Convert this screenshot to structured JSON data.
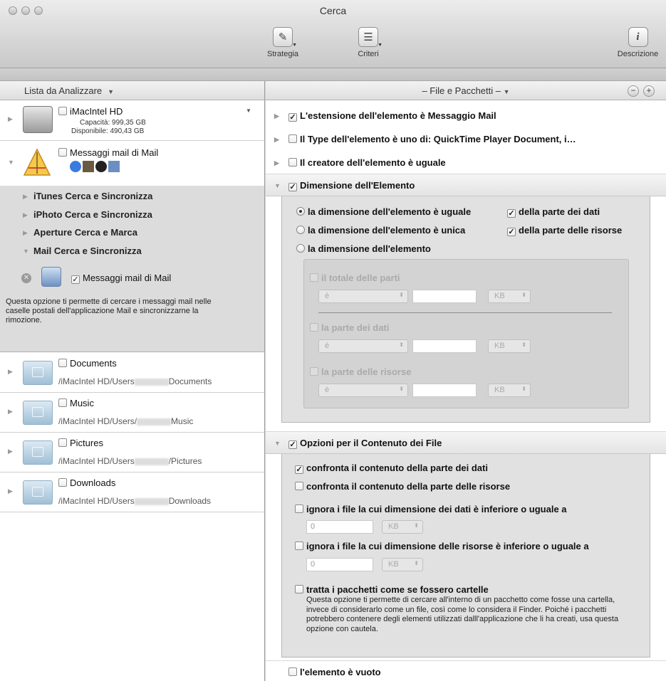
{
  "window": {
    "title": "Cerca"
  },
  "toolbar": {
    "strategy": "Strategia",
    "criteria": "Criteri",
    "description": "Descrizione"
  },
  "left": {
    "header": "Lista da Analizzare",
    "disk": {
      "name": "iMacIntel HD",
      "capacity": "Capacità: 999,35 GB",
      "available": "Disponibile: 490,43 GB"
    },
    "mail": {
      "name": "Messaggi mail di Mail",
      "sections": [
        "iTunes Cerca e Sincronizza",
        "iPhoto Cerca e Sincronizza",
        "Aperture Cerca e Marca",
        "Mail Cerca e Sincronizza"
      ],
      "option": "Messaggi mail di Mail",
      "description": "Questa opzione ti permette di cercare i messaggi mail nelle caselle postali dell'applicazione Mail e sincronizzarne la rimozione."
    },
    "folders": [
      {
        "name": "Documents",
        "path_a": "/iMacIntel HD/Users",
        "path_b": "Documents"
      },
      {
        "name": "Music",
        "path_a": "/iMacIntel HD/Users/",
        "path_b": "Music"
      },
      {
        "name": "Pictures",
        "path_a": "/iMacIntel HD/Users",
        "path_b": "/Pictures"
      },
      {
        "name": "Downloads",
        "path_a": "/iMacIntel HD/Users",
        "path_b": "Downloads"
      }
    ]
  },
  "right": {
    "header": "– File e Pacchetti –",
    "criteria": [
      "L'estensione dell'elemento è Messaggio Mail",
      "Il Type dell'elemento è uno di: QuickTime Player Document, i…",
      "Il creatore dell'elemento è uguale",
      "Dimensione dell'Elemento"
    ],
    "size": {
      "radio1": "la dimensione dell'elemento è uguale",
      "radio2": "la dimensione dell'elemento è unica",
      "radio3": "la dimensione dell'elemento",
      "check_data": "della parte dei dati",
      "check_res": "della parte delle risorse",
      "total": "il totale delle parti",
      "data_part": "la parte dei dati",
      "res_part": "la parte delle risorse",
      "op": "è",
      "unit": "KB"
    },
    "content": {
      "title": "Opzioni per il Contenuto dei File",
      "cmp_data": "confronta il contenuto della parte dei dati",
      "cmp_res": "confronta il contenuto della parte delle risorse",
      "ign_data": "ignora i file la cui dimensione dei dati è inferiore o uguale a",
      "ign_res": "ignora i file la cui dimensione delle risorse è inferiore o uguale a",
      "zero": "0",
      "unit": "KB",
      "packages": "tratta i pacchetti come se fossero cartelle",
      "packages_note": "Questa opzione ti permette di cercare all'interno di un pacchetto come fosse una cartella, invece di considerarlo come un file, così come lo considera il Finder. Poiché i pacchetti potrebbero contenere degli elementi utilizzati dalll'applicazione che li ha creati, usa questa opzione con cautela."
    },
    "empty": "l'elemento è vuoto"
  }
}
